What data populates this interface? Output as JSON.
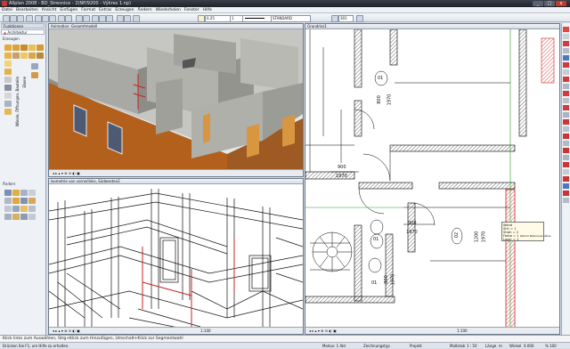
{
  "window": {
    "title": "Allplan 2008 - BD_Stresnice - 2(NP/9200 - Výkres 1.np)"
  },
  "menu": [
    "Datei",
    "Bearbeiten",
    "Ansicht",
    "Einfügen",
    "Format",
    "Extras",
    "Erzeugen",
    "Ändern",
    "Wiederholen",
    "Fenster",
    "Hilfe"
  ],
  "toolbar": {
    "pen_value": "0.25",
    "line_value": "1",
    "style_value": "STANDARD",
    "number_value": "301"
  },
  "left_panel": {
    "title": "Funktionen",
    "module": "Architektur",
    "section_create": "Erzeugen",
    "section_modify": "Ändern",
    "tabs": [
      "Wände, Öffnungen, Bauteile",
      "Ebene"
    ]
  },
  "viewports": {
    "top_left": {
      "title": "Animation: Gesamtmodell",
      "scale": ""
    },
    "bottom_left": {
      "title": "Isometrie von vorne/links, Südwesten2",
      "scale": "1:100"
    },
    "right": {
      "title": "Grundriss1",
      "scale": "1:100"
    }
  },
  "plan_labels": {
    "door1": {
      "num": "01",
      "w": "800",
      "h": "1970"
    },
    "door2": {
      "w": "900",
      "h": "1970"
    },
    "door3": {
      "w": "900",
      "h": "1970"
    },
    "door4": {
      "w": "1200",
      "h": "1970"
    },
    "door5": {
      "num": "01"
    },
    "door6": {
      "num": "02"
    },
    "door7": {
      "num": "01",
      "w": "800",
      "h": "1970"
    }
  },
  "tooltip": {
    "lines": [
      "Wand",
      "Stil: = 1",
      "Stroh = 2",
      "Farbe = 1",
      "Lage: = 1"
    ],
    "extra": "Dämm Betonová stěna"
  },
  "command_line": "Klick links zum Auswählen, Strg+Klick zum Hinzufügen, Umschalt+Klick zur Segmentwahl",
  "status": {
    "left": "Drücken Sie F1, um Hilfe zu erhalten.",
    "mode": "Modus: 1 Akt",
    "type": "Zeichnungstyp",
    "project": "Projekt",
    "scale_label": "Maßstab",
    "scale": "1 : 50",
    "length": "Länge",
    "unit": "m",
    "angle": "Winkel",
    "angle_value": "0.000",
    "extra": "% 100"
  },
  "colors": {
    "accent_red": "#cc2222",
    "wall_orange": "#b4601d",
    "wall_grey": "#9a9a94",
    "floor_grey": "#c7c8c4"
  }
}
